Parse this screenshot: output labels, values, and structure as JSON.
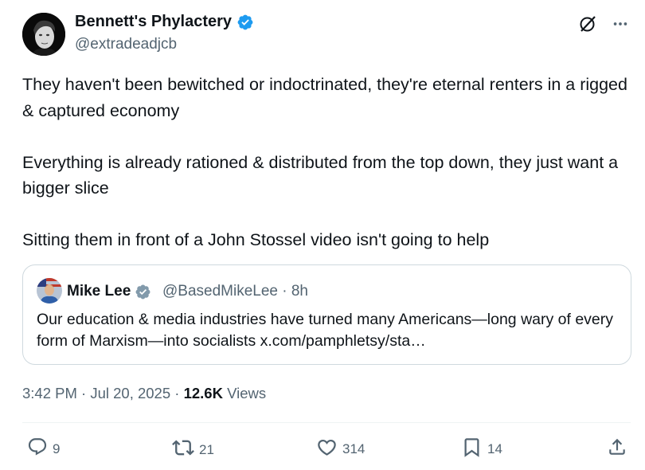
{
  "tweet": {
    "author_name": "Bennett's Phylactery",
    "author_handle": "@extradeadjcb",
    "paragraphs": [
      "They haven't been bewitched or indoctrinated, they're eternal renters  in a rigged & captured economy",
      "Everything is already rationed & distributed from the top down, they just want a bigger slice",
      "Sitting them in front of a John Stossel video isn't going to help"
    ],
    "icons": {
      "verified": "verified-badge-icon",
      "grok": "grok-icon",
      "more": "more-icon"
    },
    "colors": {
      "verified": "#1d9bf0",
      "text": "#0f1419",
      "muted": "#536471",
      "border": "#cfd9de"
    }
  },
  "quote": {
    "author_name": "Mike Lee",
    "author_handle": "@BasedMikeLee · 8h",
    "text": "Our education & media industries have turned many Americans—long wary of every form of Marxism—into socialists x.com/pamphletsy/sta…",
    "badge_color": "#829aab"
  },
  "meta": {
    "time_date": "3:42 PM · Jul 20, 2025 · ",
    "views_count": "12.6K",
    "views_label": " Views"
  },
  "actions": {
    "replies": "9",
    "reposts": "21",
    "likes": "314",
    "bookmarks": "14"
  }
}
